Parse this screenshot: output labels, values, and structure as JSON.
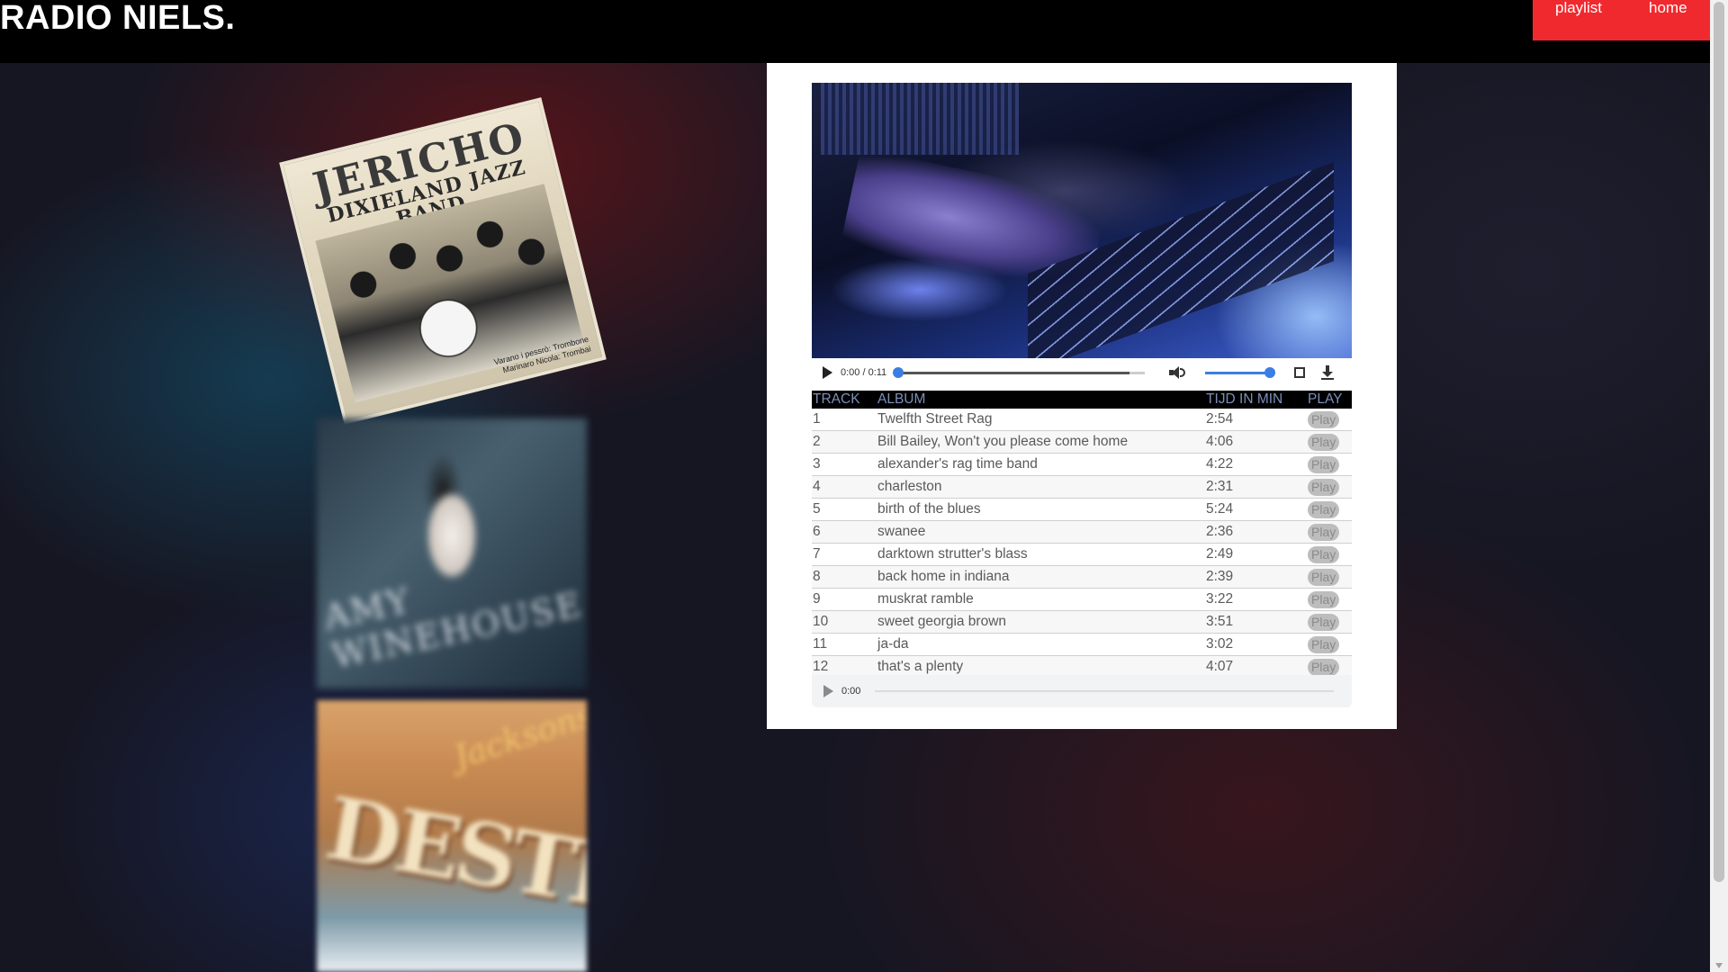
{
  "header": {
    "site_title": "RADIO NIELS.",
    "nav": {
      "playlist": "playlist",
      "home": "home"
    },
    "nav_color": "#f0292f"
  },
  "covers": {
    "jericho": {
      "title_line1": "JERICHO",
      "title_line2": "DIXIELAND JAZZ BAND",
      "credit_line1": "Varano i pessrò: Trombone",
      "credit_line2": "Marinaro Nicola: Trombai"
    },
    "amy": {
      "text": "AMY WINEHOUSE"
    },
    "destiny": {
      "title": "DESTINY",
      "script": "Jacksons"
    }
  },
  "video_player": {
    "time": "0:00 / 0:11",
    "progress": 0,
    "volume": 1.0,
    "icons": [
      "play-icon",
      "volume-icon",
      "fullscreen-icon",
      "download-icon"
    ]
  },
  "tracklist": {
    "headers": {
      "track": "TRACK",
      "album": "ALBUM",
      "time": "TIJD IN MIN",
      "play": "PLAY"
    },
    "rows": [
      {
        "track": "1",
        "album": "Twelfth Street Rag",
        "time": "2:54",
        "play": "Play"
      },
      {
        "track": "2",
        "album": "Bill Bailey, Won't you please come home",
        "time": "4:06",
        "play": "Play"
      },
      {
        "track": "3",
        "album": "alexander's rag time band",
        "time": "4:22",
        "play": "Play"
      },
      {
        "track": "4",
        "album": "charleston",
        "time": "2:31",
        "play": "Play"
      },
      {
        "track": "5",
        "album": "birth of the blues",
        "time": "5:24",
        "play": "Play"
      },
      {
        "track": "6",
        "album": "swanee",
        "time": "2:36",
        "play": "Play"
      },
      {
        "track": "7",
        "album": "darktown strutter's blass",
        "time": "2:49",
        "play": "Play"
      },
      {
        "track": "8",
        "album": "back home in indiana",
        "time": "2:39",
        "play": "Play"
      },
      {
        "track": "9",
        "album": "muskrat ramble",
        "time": "3:22",
        "play": "Play"
      },
      {
        "track": "10",
        "album": "sweet georgia brown",
        "time": "3:51",
        "play": "Play"
      },
      {
        "track": "11",
        "album": "ja-da",
        "time": "3:02",
        "play": "Play"
      },
      {
        "track": "12",
        "album": "that's a plenty",
        "time": "4:07",
        "play": "Play"
      }
    ]
  },
  "audio_player": {
    "time": "0:00"
  }
}
